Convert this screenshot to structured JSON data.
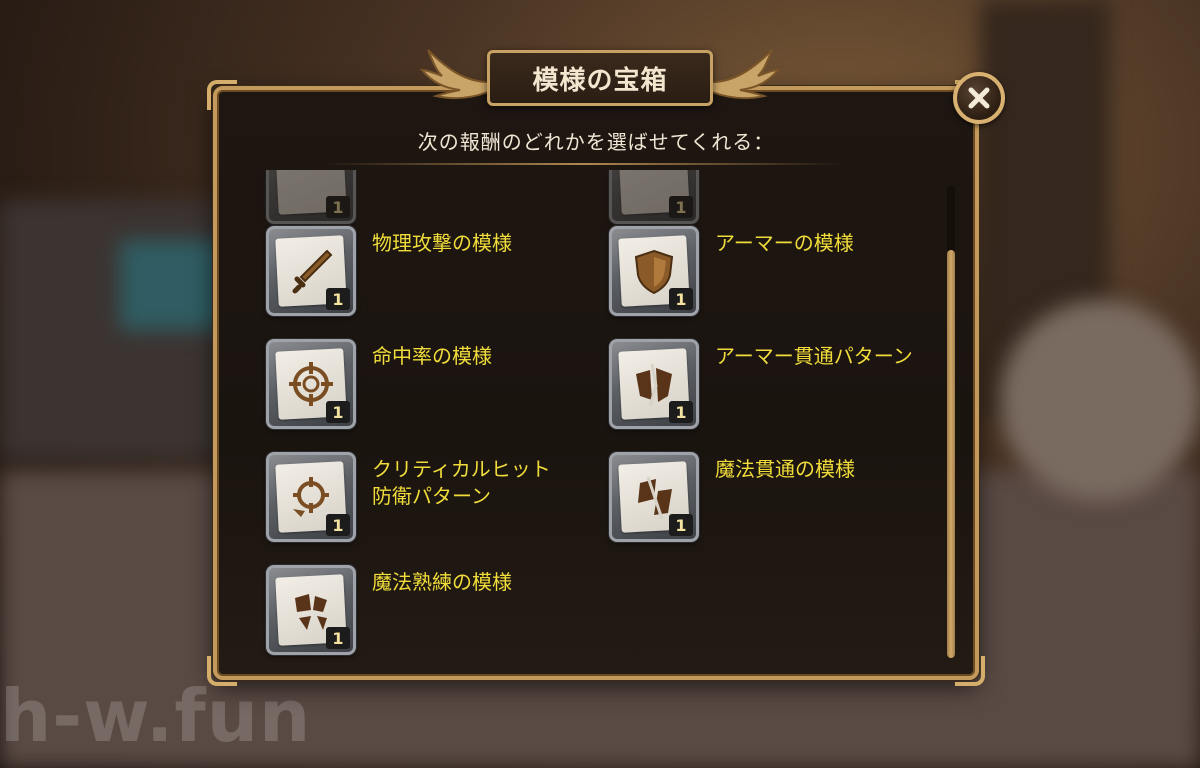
{
  "dialog": {
    "title": "模様の宝箱",
    "subtitle": "次の報酬のどれかを選ばせてくれる："
  },
  "watermark": "h-w.fun",
  "close_icon": "close-x-icon",
  "items": [
    {
      "name": "",
      "qty": "1",
      "icon": "partial-item-icon"
    },
    {
      "name": "",
      "qty": "1",
      "icon": "partial-item-icon"
    },
    {
      "name": "物理攻撃の模様",
      "qty": "1",
      "icon": "sword-icon"
    },
    {
      "name": "アーマーの模様",
      "qty": "1",
      "icon": "shield-icon"
    },
    {
      "name": "命中率の模様",
      "qty": "1",
      "icon": "crosshair-icon"
    },
    {
      "name": "アーマー貫通パターン",
      "qty": "1",
      "icon": "broken-armor-icon"
    },
    {
      "name": "クリティカルヒット\n防衛パターン",
      "qty": "1",
      "icon": "crit-defense-icon"
    },
    {
      "name": "魔法貫通の模様",
      "qty": "1",
      "icon": "magic-pierce-icon"
    },
    {
      "name": "魔法熟練の模様",
      "qty": "1",
      "icon": "magic-mastery-icon"
    }
  ],
  "colors": {
    "accent_gold": "#c39a5c",
    "item_name": "#f0dc3a",
    "panel_bg": "#1e1611"
  },
  "scroll": {
    "position": 0.14
  }
}
